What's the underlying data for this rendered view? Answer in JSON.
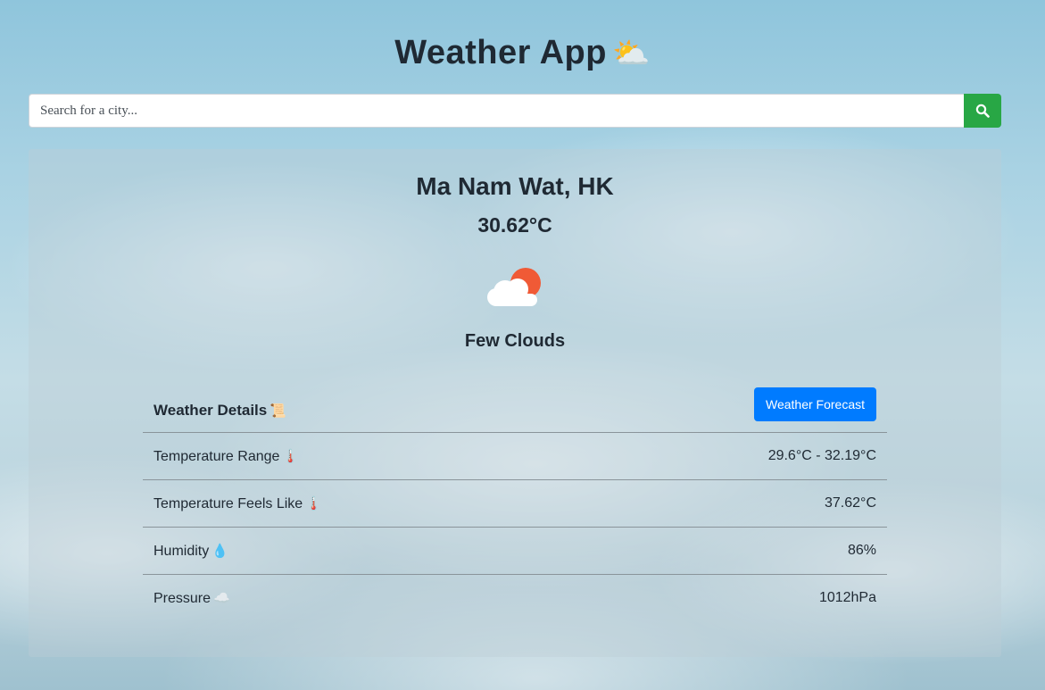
{
  "header": {
    "title": "Weather App",
    "title_emoji": "⛅"
  },
  "search": {
    "placeholder": "Search for a city...",
    "button_icon": "search-icon",
    "button_color": "#28a745"
  },
  "current": {
    "city": "Ma Nam Wat, HK",
    "temperature": "30.62°C",
    "icon": "few-clouds-icon",
    "condition": "Few Clouds"
  },
  "details": {
    "title": "Weather Details",
    "title_emoji": "📜",
    "forecast_button": "Weather Forecast",
    "forecast_button_color": "#007bff",
    "rows": [
      {
        "label": "Temperature Range",
        "emoji": "🌡️",
        "value": "29.6°C - 32.19°C"
      },
      {
        "label": "Temperature Feels Like",
        "emoji": "🌡️",
        "value": "37.62°C"
      },
      {
        "label": "Humidity",
        "emoji": "💧",
        "value": "86%"
      },
      {
        "label": "Pressure",
        "emoji": "☁️",
        "value": "1012hPa"
      }
    ]
  }
}
